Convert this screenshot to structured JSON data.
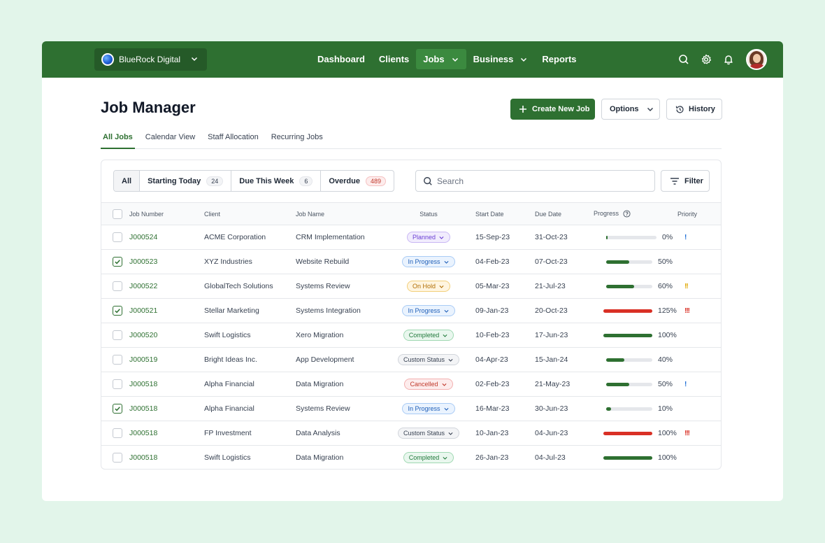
{
  "nav": {
    "org_name": "BlueRock Digital",
    "menu": [
      {
        "label": "Dashboard",
        "active": false,
        "dropdown": false
      },
      {
        "label": "Clients",
        "active": false,
        "dropdown": false
      },
      {
        "label": "Jobs",
        "active": true,
        "dropdown": true
      },
      {
        "label": "Business",
        "active": false,
        "dropdown": true
      },
      {
        "label": "Reports",
        "active": false,
        "dropdown": false
      }
    ],
    "icons": [
      "search-icon",
      "gear-icon",
      "bell-icon"
    ],
    "colors": {
      "bar": "#2e7031",
      "active": "#3b8a3f"
    }
  },
  "page": {
    "title": "Job Manager",
    "create_label": "Create New Job",
    "options_label": "Options",
    "history_label": "History"
  },
  "tabs": [
    {
      "label": "All Jobs",
      "active": true
    },
    {
      "label": "Calendar View",
      "active": false
    },
    {
      "label": "Staff Allocation",
      "active": false
    },
    {
      "label": "Recurring Jobs",
      "active": false
    }
  ],
  "segments": [
    {
      "label": "All",
      "count": null,
      "active": true
    },
    {
      "label": "Starting Today",
      "count": "24"
    },
    {
      "label": "Due This Week",
      "count": "6"
    },
    {
      "label": "Overdue",
      "count": "489",
      "alert": true
    }
  ],
  "search": {
    "placeholder": "Search"
  },
  "filter_label": "Filter",
  "table": {
    "headers": [
      "Job Number",
      "Client",
      "Job Name",
      "Status",
      "Start Date",
      "Due Date",
      "Progress",
      "Priority"
    ],
    "rows": [
      {
        "checked": false,
        "job": "J000524",
        "client": "ACME Corporation",
        "name": "CRM Implementation",
        "status": "Planned",
        "start": "15-Sep-23",
        "due": "31-Oct-23",
        "progress": 0,
        "progress_label": "0%",
        "priority": "!",
        "priority_color": "#1f6fd6"
      },
      {
        "checked": true,
        "job": "J000523",
        "client": "XYZ Industries",
        "name": "Website Rebuild",
        "status": "In Progress",
        "start": "04-Feb-23",
        "due": "07-Oct-23",
        "progress": 50,
        "progress_label": "50%",
        "priority": "",
        "priority_color": ""
      },
      {
        "checked": false,
        "job": "J000522",
        "client": "GlobalTech Solutions",
        "name": "Systems Review",
        "status": "On Hold",
        "start": "05-Mar-23",
        "due": "21-Jul-23",
        "progress": 60,
        "progress_label": "60%",
        "priority": "!!",
        "priority_color": "#e0a800"
      },
      {
        "checked": true,
        "job": "J000521",
        "client": "Stellar Marketing",
        "name": "Systems Integration",
        "status": "In Progress",
        "start": "09-Jan-23",
        "due": "20-Oct-23",
        "progress": 125,
        "progress_label": "125%",
        "priority": "!!!",
        "priority_color": "#d93025"
      },
      {
        "checked": false,
        "job": "J000520",
        "client": "Swift Logistics",
        "name": "Xero Migration",
        "status": "Completed",
        "start": "10-Feb-23",
        "due": "17-Jun-23",
        "progress": 100,
        "progress_label": "100%",
        "priority": "",
        "priority_color": ""
      },
      {
        "checked": false,
        "job": "J000519",
        "client": "Bright Ideas Inc.",
        "name": "App Development",
        "status": "Custom Status",
        "start": "04-Apr-23",
        "due": "15-Jan-24",
        "progress": 40,
        "progress_label": "40%",
        "priority": "",
        "priority_color": ""
      },
      {
        "checked": false,
        "job": "J000518",
        "client": "Alpha Financial",
        "name": "Data Migration",
        "status": "Cancelled",
        "start": "02-Feb-23",
        "due": "21-May-23",
        "progress": 50,
        "progress_label": "50%",
        "priority": "!",
        "priority_color": "#1f6fd6"
      },
      {
        "checked": true,
        "job": "J000518",
        "client": "Alpha Financial",
        "name": "Systems Review",
        "status": "In Progress",
        "start": "16-Mar-23",
        "due": "30-Jun-23",
        "progress": 10,
        "progress_label": "10%",
        "priority": "",
        "priority_color": ""
      },
      {
        "checked": false,
        "job": "J000518",
        "client": "FP Investment",
        "name": "Data Analysis",
        "status": "Custom Status",
        "start": "10-Jan-23",
        "due": "04-Jun-23",
        "progress": 100,
        "progress_label": "100%",
        "overdue": true,
        "priority": "!!!",
        "priority_color": "#d93025"
      },
      {
        "checked": false,
        "job": "J000518",
        "client": "Swift Logistics",
        "name": "Data Migration",
        "status": "Completed",
        "start": "26-Jan-23",
        "due": "04-Jul-23",
        "progress": 100,
        "progress_label": "100%",
        "priority": "",
        "priority_color": ""
      }
    ]
  },
  "status_styles": {
    "Planned": {
      "bg": "#f1ecfd",
      "border": "#c9b8f4",
      "color": "#6b3fd4"
    },
    "In Progress": {
      "bg": "#eaf3fe",
      "border": "#a9cbf5",
      "color": "#1f5fb8"
    },
    "On Hold": {
      "bg": "#fff5e0",
      "border": "#f2cf7a",
      "color": "#b06d00"
    },
    "Completed": {
      "bg": "#e9f7ee",
      "border": "#9fd8b2",
      "color": "#217a3c"
    },
    "Custom Status": {
      "bg": "#f3f4f6",
      "border": "#d1d5db",
      "color": "#374151"
    },
    "Cancelled": {
      "bg": "#fdecec",
      "border": "#f3b0b0",
      "color": "#c0392b"
    }
  },
  "progress_colors": {
    "normal": "#2e7031",
    "over": "#d93025"
  }
}
